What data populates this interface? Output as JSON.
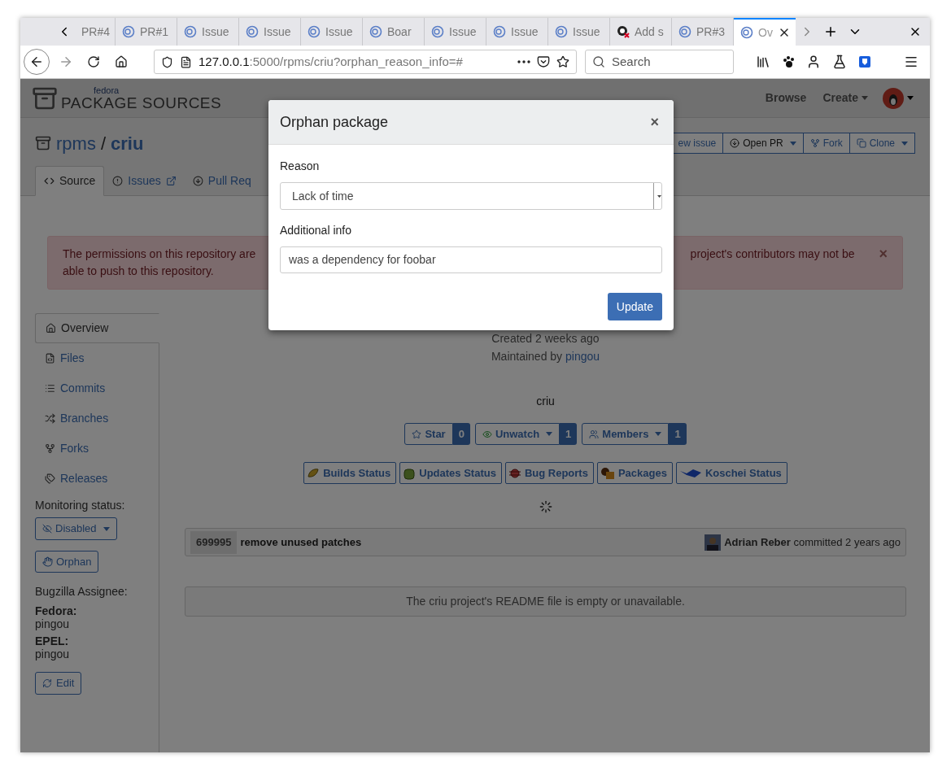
{
  "browser": {
    "tabs": [
      {
        "label": "PR#4",
        "selected": false,
        "kind": "plain"
      },
      {
        "label": "PR#1",
        "selected": false,
        "kind": "pagure"
      },
      {
        "label": "Issue",
        "selected": false,
        "kind": "pagure"
      },
      {
        "label": "Issue",
        "selected": false,
        "kind": "pagure"
      },
      {
        "label": "Issue",
        "selected": false,
        "kind": "pagure"
      },
      {
        "label": "Boar",
        "selected": false,
        "kind": "pagure"
      },
      {
        "label": "Issue",
        "selected": false,
        "kind": "pagure"
      },
      {
        "label": "Issue",
        "selected": false,
        "kind": "pagure"
      },
      {
        "label": "Issue",
        "selected": false,
        "kind": "pagure"
      },
      {
        "label": "Add s",
        "selected": false,
        "kind": "error"
      },
      {
        "label": "PR#3",
        "selected": false,
        "kind": "pagure"
      },
      {
        "label": "Ov",
        "selected": true,
        "kind": "pagure"
      }
    ],
    "url": {
      "host": "127.0.0.1",
      "path": ":5000/rpms/criu?orphan_reason_info=#"
    },
    "search": {
      "placeholder": "Search"
    }
  },
  "header": {
    "logo_small": "fedora",
    "logo": "PACKAGE SOURCES",
    "nav": [
      {
        "label": "Browse",
        "dropdown": false
      },
      {
        "label": "Create",
        "dropdown": true
      }
    ]
  },
  "repo": {
    "namespace": "rpms",
    "separator": "/",
    "name": "criu",
    "actions": [
      {
        "label": "ew issue",
        "dropdown": false
      },
      {
        "label": "Open PR",
        "dropdown": true
      },
      {
        "label": "Fork",
        "dropdown": false
      },
      {
        "label": "Clone",
        "dropdown": true
      }
    ],
    "tabs": [
      {
        "label": "Source",
        "selected": true,
        "external": false
      },
      {
        "label": "Issues",
        "selected": false,
        "external": true
      },
      {
        "label": "Pull Req",
        "selected": false,
        "external": false
      }
    ]
  },
  "alert": {
    "line1_left": "The permissions on this repository are",
    "line1_right": "project's contributors may not be",
    "line2": "able to push to this repository.",
    "close": "×"
  },
  "sidebar": {
    "items": [
      {
        "label": "Overview",
        "selected": true
      },
      {
        "label": "Files",
        "selected": false
      },
      {
        "label": "Commits",
        "selected": false
      },
      {
        "label": "Branches",
        "selected": false
      },
      {
        "label": "Forks",
        "selected": false
      },
      {
        "label": "Releases",
        "selected": false
      }
    ],
    "monitoring_label": "Monitoring status:",
    "monitoring": "Disabled",
    "orphan": "Orphan",
    "bugzilla_label": "Bugzilla Assignee:",
    "assignees": [
      {
        "branch": "Fedora:",
        "user": "pingou"
      },
      {
        "branch": "EPEL:",
        "user": "pingou"
      }
    ],
    "edit": "Edit"
  },
  "overview": {
    "created": "Created 2 weeks ago",
    "maintained_prefix": "Maintained by",
    "maintainer": "pingou",
    "title": "criu",
    "counters": [
      {
        "label": "Star",
        "count": "0",
        "dropdown": false
      },
      {
        "label": "Unwatch",
        "count": "1",
        "dropdown": true
      },
      {
        "label": "Members",
        "count": "1",
        "dropdown": true
      }
    ],
    "badges": [
      "Builds Status",
      "Updates Status",
      "Bug Reports",
      "Packages",
      "Koschei Status"
    ],
    "commit": {
      "hash": "699995",
      "message": "remove unused patches",
      "author": "Adrian Reber",
      "action": "committed 2 years ago"
    },
    "readme": "The criu project's README file is empty or unavailable."
  },
  "modal": {
    "title": "Orphan package",
    "close": "×",
    "reason_label": "Reason",
    "reason": "Lack of time",
    "info_label": "Additional info",
    "info": "was a dependency for foobar",
    "submit": "Update"
  }
}
